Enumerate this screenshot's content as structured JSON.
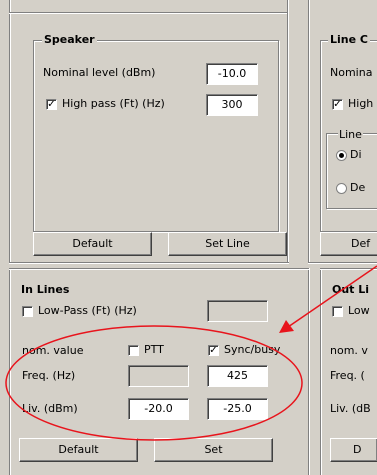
{
  "speaker": {
    "title": "Speaker",
    "nominal_level_label": "Nominal level (dBm)",
    "nominal_level_value": "-10.0",
    "highpass_label": "High pass (Ft) (Hz)",
    "highpass_checked": true,
    "highpass_value": "300",
    "default_button": "Default",
    "set_line_button": "Set Line"
  },
  "line_c": {
    "title": "Line C",
    "nominal_label": "Nomina",
    "high_label": "High",
    "line_sub_label": "Line",
    "radio1_label": "Di",
    "radio2_label": "De",
    "default_button": "Def"
  },
  "in_lines": {
    "title": "In Lines",
    "lowpass_label": "Low-Pass (Ft) (Hz)",
    "lowpass_checked": false,
    "nom_value_label": "nom. value",
    "ptt_label": "PTT",
    "ptt_checked": false,
    "sync_label": "Sync/busy",
    "sync_checked": true,
    "freq_label": "Freq. (Hz)",
    "freq_value": "425",
    "liv_label": "Liv. (dBm)",
    "liv_value1": "-20.0",
    "liv_value2": "-25.0",
    "default_button": "Default",
    "set_button": "Set"
  },
  "out_lines": {
    "title": "Out Li",
    "low_label": "Low",
    "nom_label": "nom. v",
    "freq_label": "Freq. (",
    "liv_label": "Liv. (dB",
    "default_button": "D"
  },
  "annotation": {
    "color": "#e8141c"
  }
}
